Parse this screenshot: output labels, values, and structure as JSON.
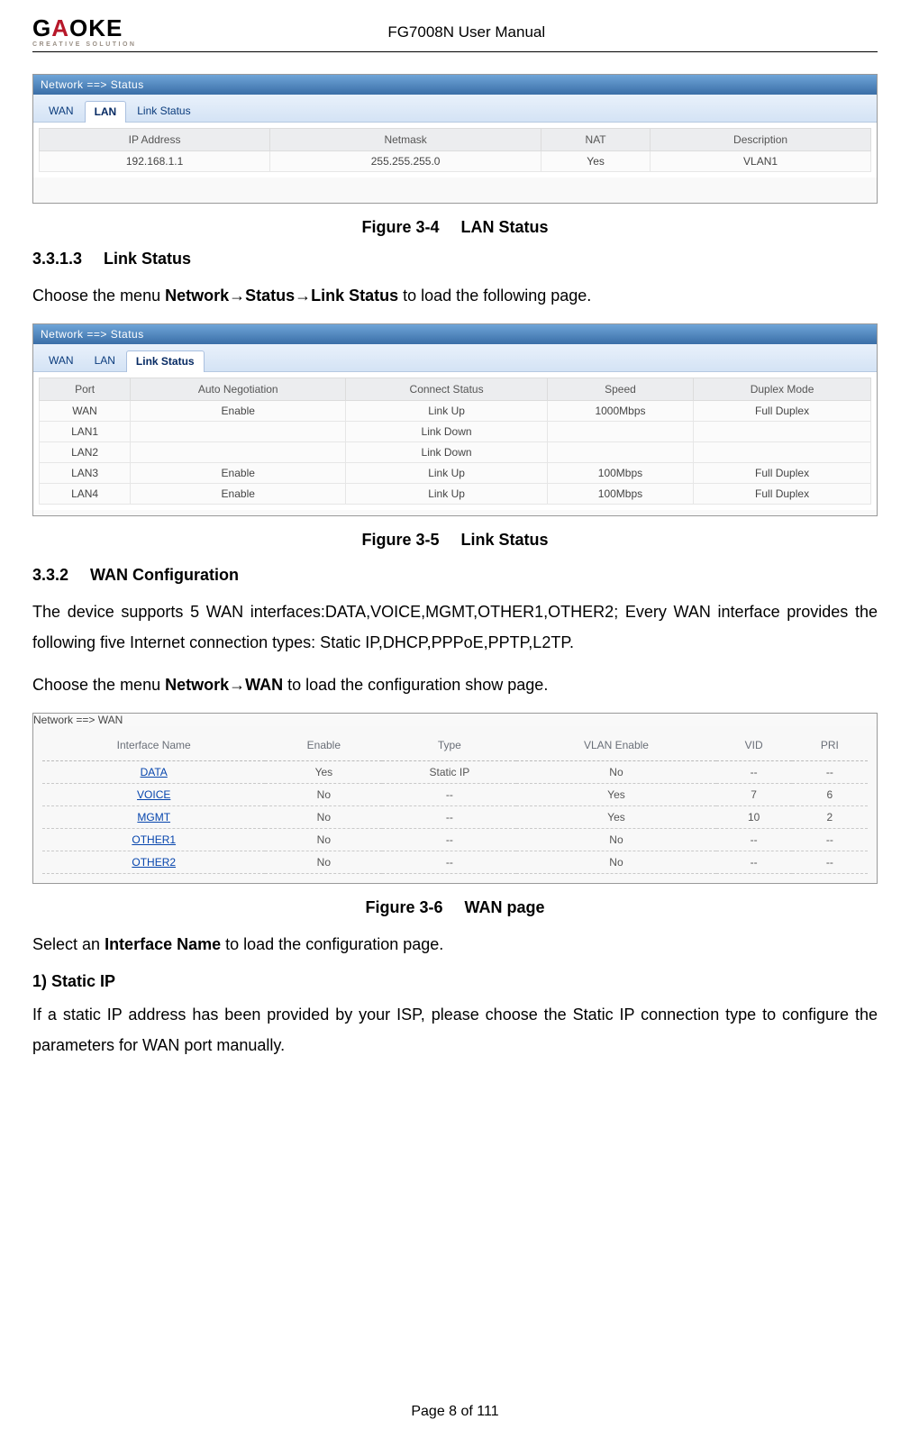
{
  "header": {
    "logo_main_pre": "G",
    "logo_main_red": "A",
    "logo_main_post": "OKE",
    "logo_sub": "CREATIVE SOLUTION",
    "doc_title": "FG7008N User Manual"
  },
  "fig34": {
    "caption_num": "Figure 3-4",
    "caption_title": "LAN Status",
    "breadcrumb": "Network ==> Status",
    "tabs": [
      "WAN",
      "LAN",
      "Link Status"
    ],
    "active_tab_index": 1,
    "headers": [
      "IP Address",
      "Netmask",
      "NAT",
      "Description"
    ],
    "rows": [
      [
        "192.168.1.1",
        "255.255.255.0",
        "Yes",
        "VLAN1"
      ]
    ]
  },
  "sec3313": {
    "num": "3.3.1.3",
    "title": "Link Status",
    "text_pre": "Choose the menu ",
    "text_bold": "Network→Status→Link Status",
    "text_post": " to load the following page."
  },
  "fig35": {
    "caption_num": "Figure 3-5",
    "caption_title": "Link Status",
    "breadcrumb": "Network ==> Status",
    "tabs": [
      "WAN",
      "LAN",
      "Link Status"
    ],
    "active_tab_index": 2,
    "headers": [
      "Port",
      "Auto Negotiation",
      "Connect Status",
      "Speed",
      "Duplex Mode"
    ],
    "rows": [
      [
        "WAN",
        "Enable",
        "Link Up",
        "1000Mbps",
        "Full Duplex"
      ],
      [
        "LAN1",
        "",
        "Link Down",
        "",
        ""
      ],
      [
        "LAN2",
        "",
        "Link Down",
        "",
        ""
      ],
      [
        "LAN3",
        "Enable",
        "Link Up",
        "100Mbps",
        "Full Duplex"
      ],
      [
        "LAN4",
        "Enable",
        "Link Up",
        "100Mbps",
        "Full Duplex"
      ]
    ]
  },
  "sec332": {
    "num": "3.3.2",
    "title": "WAN Configuration",
    "para1": "The device supports 5 WAN interfaces:DATA,VOICE,MGMT,OTHER1,OTHER2; Every WAN interface provides the following five Internet connection types: Static IP,DHCP,PPPoE,PPTP,L2TP.",
    "para2_pre": "Choose the menu ",
    "para2_bold": "Network→WAN",
    "para2_post": " to load the configuration show page."
  },
  "fig36": {
    "caption_num": "Figure 3-6",
    "caption_title": "WAN page",
    "breadcrumb": "Network ==> WAN",
    "headers": [
      "Interface Name",
      "Enable",
      "Type",
      "VLAN Enable",
      "VID",
      "PRI"
    ],
    "rows": [
      {
        "name": "DATA",
        "enable": "Yes",
        "type": "Static IP",
        "vlan": "No",
        "vid": "--",
        "pri": "--"
      },
      {
        "name": "VOICE",
        "enable": "No",
        "type": "--",
        "vlan": "Yes",
        "vid": "7",
        "pri": "6"
      },
      {
        "name": "MGMT",
        "enable": "No",
        "type": "--",
        "vlan": "Yes",
        "vid": "10",
        "pri": "2"
      },
      {
        "name": "OTHER1",
        "enable": "No",
        "type": "--",
        "vlan": "No",
        "vid": "--",
        "pri": "--"
      },
      {
        "name": "OTHER2",
        "enable": "No",
        "type": "--",
        "vlan": "No",
        "vid": "--",
        "pri": "--"
      }
    ]
  },
  "after_fig36": {
    "para_pre": "Select an ",
    "para_bold": "Interface Name",
    "para_post": " to load the configuration page.",
    "sub_heading": "1) Static IP",
    "para_static": "If a static IP address has been provided by your ISP, please choose the Static IP connection type to configure the parameters for WAN port manually."
  },
  "footer": {
    "page_label": "Page 8 of 111"
  }
}
